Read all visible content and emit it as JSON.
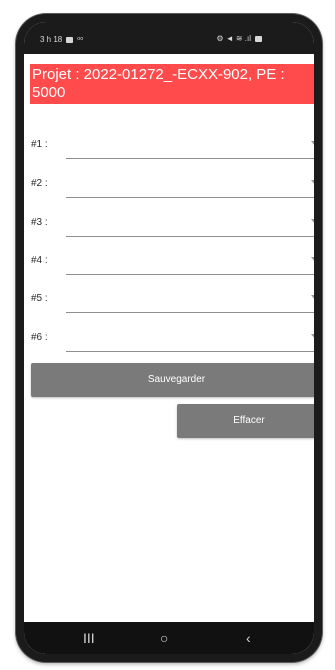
{
  "status": {
    "time": "3 h 18",
    "right": "⚙ ◄ ≋ .ıl"
  },
  "header": {
    "title": "Projet : 2022-01272_-ECXX-902, PE : 5000"
  },
  "form": {
    "rows": [
      {
        "label": "#1 :"
      },
      {
        "label": "#2 :"
      },
      {
        "label": "#3 :"
      },
      {
        "label": "#4 :"
      },
      {
        "label": "#5 :"
      },
      {
        "label": "#6 :"
      }
    ]
  },
  "actions": {
    "save_label": "Sauvegarder",
    "clear_label": "Effacer"
  },
  "nav": {
    "recent": "III",
    "home": "○",
    "back": "‹"
  },
  "colors": {
    "header": "#ff4b4b",
    "button": "#7a7a7a"
  }
}
